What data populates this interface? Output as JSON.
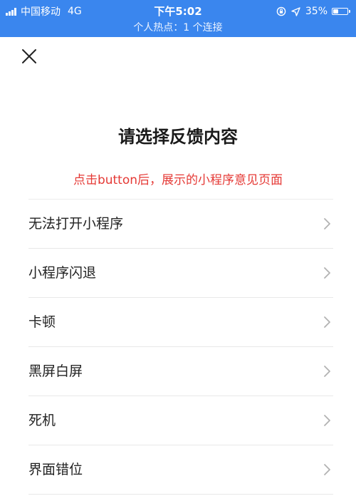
{
  "status_bar": {
    "carrier": "中国移动",
    "network": "4G",
    "time": "下午5:02",
    "battery_percent": "35%",
    "battery_level": 0.35,
    "hotspot_text": "个人热点：1 个连接"
  },
  "page": {
    "title": "请选择反馈内容",
    "note": "点击button后，展示的小程序意见页面"
  },
  "feedback_options": [
    {
      "label": "无法打开小程序"
    },
    {
      "label": "小程序闪退"
    },
    {
      "label": "卡顿"
    },
    {
      "label": "黑屏白屏"
    },
    {
      "label": "死机"
    },
    {
      "label": "界面错位"
    }
  ],
  "colors": {
    "status_bar_bg": "#3a86ee",
    "note_text": "#e53935",
    "chevron": "#b2b2b2"
  }
}
